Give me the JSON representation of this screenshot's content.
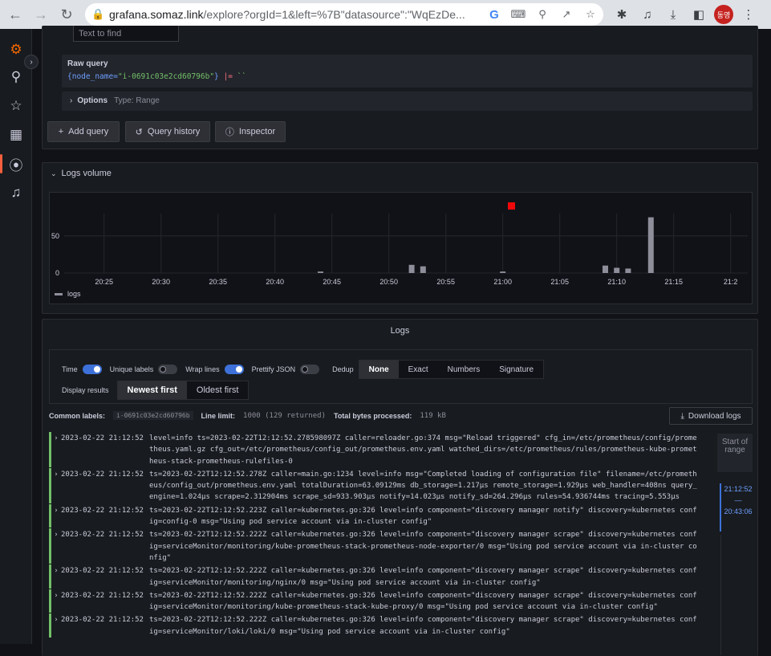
{
  "browser": {
    "url_host": "grafana.somaz.link",
    "url_rest": "/explore?orgId=1&left=%7B\"datasource\":\"WqEzDe...",
    "avatar_text": "동영",
    "icons": [
      "back-arrow-icon",
      "forward-arrow-icon",
      "reload-icon",
      "lock-icon",
      "google-icon",
      "translate-icon",
      "zoom-icon",
      "share-icon",
      "star-icon",
      "extensions-icon",
      "media-icon",
      "download-icon",
      "sidepanel-icon",
      "more-icon"
    ]
  },
  "sidenav": {
    "icons": [
      "grafana-logo-icon",
      "search-icon",
      "starred-icon",
      "dashboards-icon",
      "explore-icon",
      "alerting-icon"
    ]
  },
  "query": {
    "text_find_placeholder": "Text to find",
    "raw_query_label": "Raw query",
    "raw_query_open": "{",
    "raw_query_key": "node_name=",
    "raw_query_value": "\"i-0691c03e2cd60796b\"",
    "raw_query_close": "}",
    "raw_query_op": " |= ",
    "raw_query_tail": "``",
    "options_label": "Options",
    "options_type": "Type: Range",
    "add_query": "Add query",
    "query_history": "Query history",
    "inspector": "Inspector"
  },
  "logs_volume": {
    "title": "Logs volume",
    "legend": "logs",
    "colors": {
      "bar": "#8e8e9b",
      "marker": "#f0080a"
    }
  },
  "chart_data": {
    "type": "bar",
    "title": "Logs volume",
    "x_ticks": [
      "20:25",
      "20:30",
      "20:35",
      "20:40",
      "20:45",
      "20:50",
      "20:55",
      "21:00",
      "21:05",
      "21:10",
      "21:15",
      "21:2"
    ],
    "y_ticks": [
      "50",
      "0"
    ],
    "ylim": [
      0,
      80
    ],
    "series": [
      {
        "name": "logs",
        "x": [
          "20:44",
          "20:52",
          "20:53",
          "21:00",
          "21:09",
          "21:10",
          "21:11",
          "21:13"
        ],
        "values": [
          2,
          11,
          9,
          2,
          10,
          7,
          6,
          75
        ]
      }
    ]
  },
  "logs": {
    "title": "Logs",
    "toggles": [
      {
        "label": "Time",
        "on": true
      },
      {
        "label": "Unique labels",
        "on": false
      },
      {
        "label": "Wrap lines",
        "on": true
      },
      {
        "label": "Prettify JSON",
        "on": false
      }
    ],
    "dedup_label": "Dedup",
    "dedup_options": [
      "None",
      "Exact",
      "Numbers",
      "Signature"
    ],
    "dedup_selected": "None",
    "display_results_label": "Display results",
    "order_options": [
      "Newest first",
      "Oldest first"
    ],
    "order_selected": "Newest first",
    "common_labels_label": "Common labels:",
    "common_labels_value": "i-0691c03e2cd60796b",
    "line_limit_label": "Line limit:",
    "line_limit_value": "1000 (129 returned)",
    "bytes_label": "Total bytes processed:",
    "bytes_value": "119 kB",
    "download_label": "Download logs",
    "range_label": "Start of range",
    "range_start": "21:12:52",
    "range_dash": "—",
    "range_end": "20:43:06",
    "rows": [
      {
        "ts": "2023-02-22 21:12:52",
        "msg": "level=info ts=2023-02-22T12:12:52.278598097Z caller=reloader.go:374 msg=\"Reload triggered\" cfg_in=/etc/prometheus/config/prometheus.yaml.gz cfg_out=/etc/prometheus/config_out/prometheus.env.yaml watched_dirs=/etc/prometheus/rules/prometheus-kube-prometheus-stack-prometheus-rulefiles-0"
      },
      {
        "ts": "2023-02-22 21:12:52",
        "msg": "ts=2023-02-22T12:12:52.278Z caller=main.go:1234 level=info msg=\"Completed loading of configuration file\" filename=/etc/prometheus/config_out/prometheus.env.yaml totalDuration=63.09129ms db_storage=1.217µs remote_storage=1.929µs web_handler=408ns query_engine=1.024µs scrape=2.312904ms scrape_sd=933.903µs notify=14.023µs notify_sd=264.296µs rules=54.936744ms tracing=5.553µs"
      },
      {
        "ts": "2023-02-22 21:12:52",
        "msg": "ts=2023-02-22T12:12:52.223Z caller=kubernetes.go:326 level=info component=\"discovery manager notify\" discovery=kubernetes config=config-0 msg=\"Using pod service account via in-cluster config\""
      },
      {
        "ts": "2023-02-22 21:12:52",
        "msg": "ts=2023-02-22T12:12:52.222Z caller=kubernetes.go:326 level=info component=\"discovery manager scrape\" discovery=kubernetes config=serviceMonitor/monitoring/kube-prometheus-stack-prometheus-node-exporter/0 msg=\"Using pod service account via in-cluster config\""
      },
      {
        "ts": "2023-02-22 21:12:52",
        "msg": "ts=2023-02-22T12:12:52.222Z caller=kubernetes.go:326 level=info component=\"discovery manager scrape\" discovery=kubernetes config=serviceMonitor/monitoring/nginx/0 msg=\"Using pod service account via in-cluster config\""
      },
      {
        "ts": "2023-02-22 21:12:52",
        "msg": "ts=2023-02-22T12:12:52.222Z caller=kubernetes.go:326 level=info component=\"discovery manager scrape\" discovery=kubernetes config=serviceMonitor/monitoring/kube-prometheus-stack-kube-proxy/0 msg=\"Using pod service account via in-cluster config\""
      },
      {
        "ts": "2023-02-22 21:12:52",
        "msg": "ts=2023-02-22T12:12:52.222Z caller=kubernetes.go:326 level=info component=\"discovery manager scrape\" discovery=kubernetes config=serviceMonitor/loki/loki/0 msg=\"Using pod service account via in-cluster config\""
      }
    ]
  }
}
